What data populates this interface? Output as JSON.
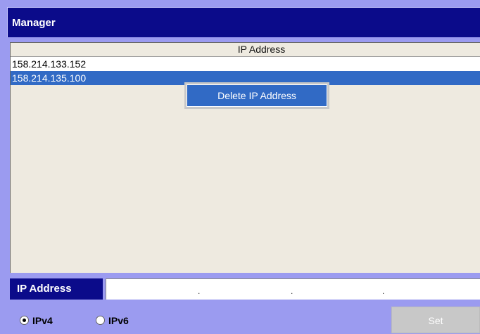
{
  "window": {
    "title": "Manager"
  },
  "table": {
    "column_header": "IP Address",
    "rows": [
      "158.214.133.152",
      "158.214.135.100"
    ],
    "selected_index": 1
  },
  "context_menu": {
    "items": [
      "Delete IP Address"
    ]
  },
  "ip_field": {
    "label": "IP Address",
    "separators": [
      ".",
      ".",
      "."
    ]
  },
  "ip_version": {
    "options": [
      "IPv4",
      "IPv6"
    ],
    "selected": "IPv4"
  },
  "buttons": {
    "set_label": "Set"
  },
  "colors": {
    "title_bar": "#0b0b8a",
    "background": "#9b9bf0",
    "selection": "#316ac5",
    "panel": "#eeeae0"
  }
}
